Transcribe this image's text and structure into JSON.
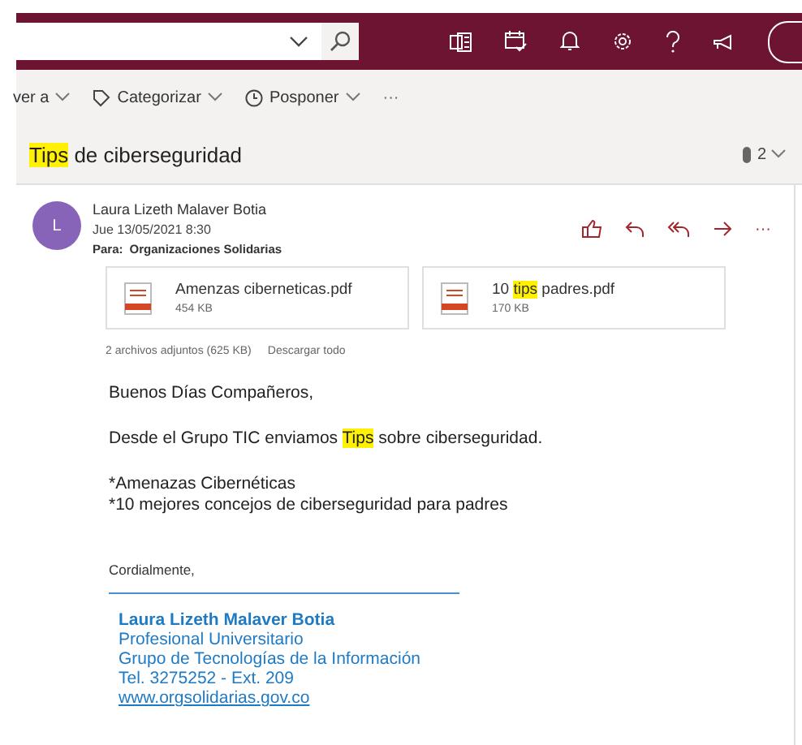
{
  "toolbar": {
    "actions": [
      {
        "label": "ver a"
      },
      {
        "label": "Categorizar"
      },
      {
        "label": "Posponer"
      }
    ],
    "more": "···"
  },
  "subject": {
    "segments": [
      {
        "text": "Tips",
        "highlighted": true
      },
      {
        "text": " de ciberseguridad",
        "highlighted": false
      }
    ]
  },
  "attachment_count": "2",
  "message": {
    "avatar": "L",
    "sender": "Laura Lizeth Malaver Botia",
    "date": "Jue 13/05/2021 8:30",
    "to_label": "Para:",
    "to": "Organizaciones Solidarias",
    "more": "···",
    "attachments": [
      {
        "name": [
          {
            "text": "Amenzas ciberneticas.pdf",
            "highlighted": false
          }
        ],
        "size": "454 KB"
      },
      {
        "name": [
          {
            "text": "10 ",
            "highlighted": false
          },
          {
            "text": "tips",
            "highlighted": true
          },
          {
            "text": " padres.pdf",
            "highlighted": false
          }
        ],
        "size": "170 KB"
      }
    ],
    "attachments_summary": "2 archivos adjuntos (625 KB)",
    "download_all": "Descargar todo",
    "body": [
      [
        {
          "text": "Buenos Días Compañeros,",
          "highlighted": false
        }
      ],
      [
        {
          "text": "Desde el Grupo TIC enviamos ",
          "highlighted": false
        },
        {
          "text": "Tips",
          "highlighted": true
        },
        {
          "text": " sobre ciberseguridad.",
          "highlighted": false
        }
      ]
    ],
    "list": [
      "*Amenazas Cibernéticas",
      "*10 mejores concejos de ciberseguridad para padres"
    ],
    "closing": "Cordialmente,",
    "signature": {
      "name": "Laura Lizeth Malaver Botia",
      "lines": [
        "Profesional Universitario",
        "Grupo de Tecnologías de la Información",
        "Tel. 3275252 - Ext. 209"
      ],
      "link": "www.orgsolidarias.gov.co"
    }
  }
}
